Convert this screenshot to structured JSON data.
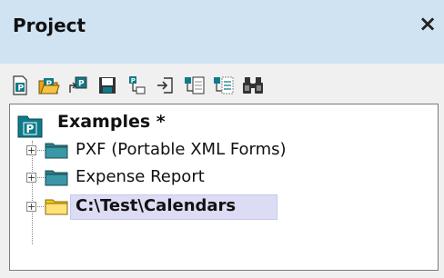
{
  "panel": {
    "title": "Project",
    "close_label": "×"
  },
  "toolbar": {
    "buttons": [
      {
        "name": "new-project-icon"
      },
      {
        "name": "open-project-icon"
      },
      {
        "name": "reload-project-icon"
      },
      {
        "name": "save-project-icon"
      },
      {
        "name": "add-files-icon"
      },
      {
        "name": "add-url-icon"
      },
      {
        "name": "add-active-file-icon"
      },
      {
        "name": "add-related-files-icon"
      },
      {
        "name": "find-in-project-icon"
      }
    ]
  },
  "tree": {
    "root": {
      "label": "Examples *"
    },
    "items": [
      {
        "label": "PXF (Portable XML Forms)",
        "folder_color": "#2e7d8a",
        "expander": "+"
      },
      {
        "label": "Expense Report",
        "folder_color": "#2e7d8a",
        "expander": "+"
      },
      {
        "label": "C:\\Test\\Calendars",
        "folder_color": "#f5c518",
        "expander": "+",
        "selected": true
      }
    ]
  }
}
